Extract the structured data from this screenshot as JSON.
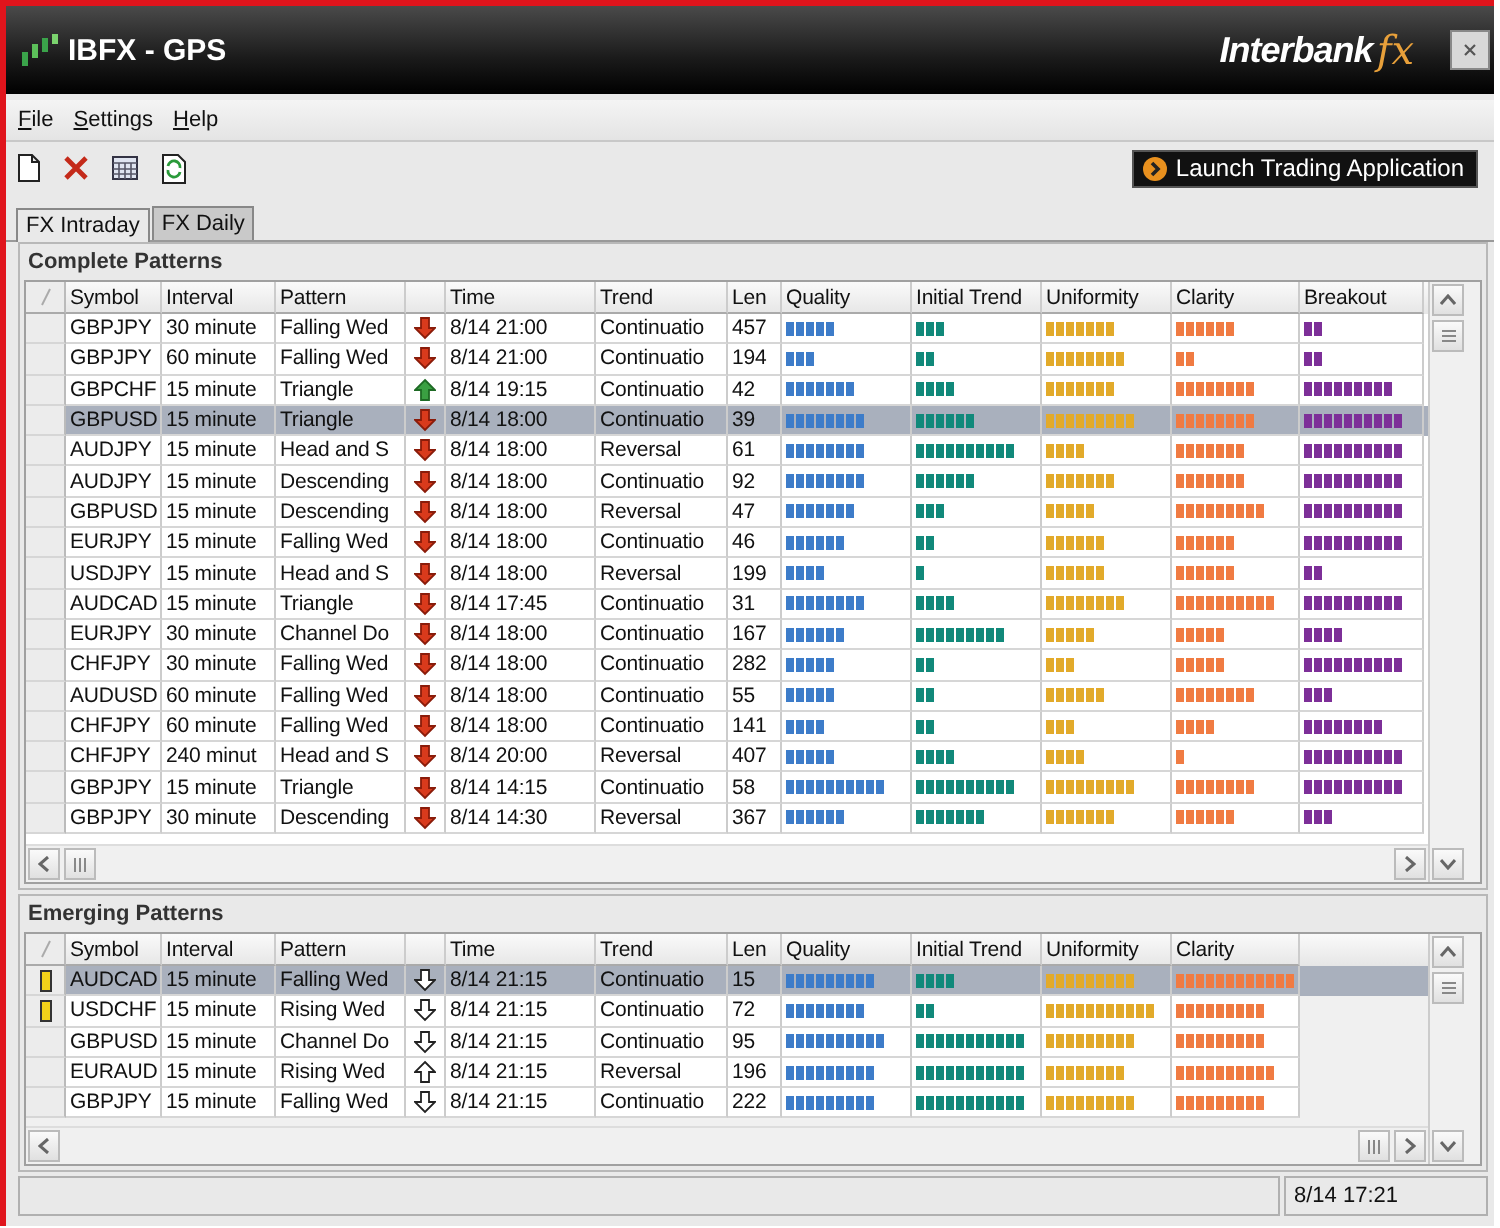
{
  "window": {
    "title": "IBFX - GPS",
    "brand": "Interbank",
    "brand_suffix": "fx"
  },
  "menu": [
    {
      "label": "File"
    },
    {
      "label": "Settings"
    },
    {
      "label": "Help"
    }
  ],
  "toolbar": {
    "launch_button": "Launch Trading Application"
  },
  "tabs": [
    {
      "label": "FX Intraday",
      "selected": true
    },
    {
      "label": "FX Daily",
      "selected": false
    }
  ],
  "complete_patterns": {
    "title": "Complete Patterns",
    "hollow_arrows": false,
    "columns": [
      {
        "label": "Symbol",
        "kind": "text"
      },
      {
        "label": "Interval",
        "kind": "text"
      },
      {
        "label": "Pattern",
        "kind": "text"
      },
      {
        "kind": "direction"
      },
      {
        "label": "Time",
        "kind": "text"
      },
      {
        "label": "Trend",
        "kind": "text"
      },
      {
        "label": "Len",
        "kind": "text"
      },
      {
        "label": "Quality",
        "kind": "bar",
        "color": "#3d7cc9"
      },
      {
        "label": "Initial Trend",
        "kind": "bar",
        "color": "#11897a"
      },
      {
        "label": "Uniformity",
        "kind": "bar",
        "color": "#e2aa2a"
      },
      {
        "label": "Clarity",
        "kind": "bar",
        "color": "#f07b42"
      },
      {
        "label": "Breakout",
        "kind": "bar",
        "color": "#7d2f98"
      }
    ],
    "rows": [
      {
        "selected": false,
        "cells": [
          "GBPJPY",
          "30 minute",
          "Falling Wed",
          {
            "up": false
          },
          "8/14 21:00",
          "Continuatio",
          "457",
          {
            "level": 0.42
          },
          {
            "level": 0.25
          },
          {
            "level": 0.58
          },
          {
            "level": 0.5
          },
          {
            "level": 0.17
          }
        ]
      },
      {
        "selected": false,
        "cells": [
          "GBPJPY",
          "60 minute",
          "Falling Wed",
          {
            "up": false
          },
          "8/14 21:00",
          "Continuatio",
          "194",
          {
            "level": 0.25
          },
          {
            "level": 0.17
          },
          {
            "level": 0.67
          },
          {
            "level": 0.17
          },
          {
            "level": 0.17
          }
        ]
      },
      {
        "selected": false,
        "cells": [
          "GBPCHF",
          "15 minute",
          "Triangle",
          {
            "up": true
          },
          "8/14 19:15",
          "Continuatio",
          "42",
          {
            "level": 0.58
          },
          {
            "level": 0.33
          },
          {
            "level": 0.58
          },
          {
            "level": 0.67
          },
          {
            "level": 0.75
          }
        ]
      },
      {
        "selected": true,
        "cells": [
          "GBPUSD",
          "15 minute",
          "Triangle",
          {
            "up": false
          },
          "8/14 18:00",
          "Continuatio",
          "39",
          {
            "level": 0.67
          },
          {
            "level": 0.5
          },
          {
            "level": 0.75
          },
          {
            "level": 0.67
          },
          {
            "level": 0.83
          }
        ]
      },
      {
        "selected": false,
        "cells": [
          "AUDJPY",
          "15 minute",
          "Head and S",
          {
            "up": false
          },
          "8/14 18:00",
          "Reversal",
          "61",
          {
            "level": 0.67
          },
          {
            "level": 0.83
          },
          {
            "level": 0.33
          },
          {
            "level": 0.58
          },
          {
            "level": 0.83
          }
        ]
      },
      {
        "selected": false,
        "cells": [
          "AUDJPY",
          "15 minute",
          "Descending",
          {
            "up": false
          },
          "8/14 18:00",
          "Continuatio",
          "92",
          {
            "level": 0.67
          },
          {
            "level": 0.5
          },
          {
            "level": 0.58
          },
          {
            "level": 0.58
          },
          {
            "level": 0.83
          }
        ]
      },
      {
        "selected": false,
        "cells": [
          "GBPUSD",
          "15 minute",
          "Descending",
          {
            "up": false
          },
          "8/14 18:00",
          "Reversal",
          "47",
          {
            "level": 0.58
          },
          {
            "level": 0.25
          },
          {
            "level": 0.42
          },
          {
            "level": 0.75
          },
          {
            "level": 0.83
          }
        ]
      },
      {
        "selected": false,
        "cells": [
          "EURJPY",
          "15 minute",
          "Falling Wed",
          {
            "up": false
          },
          "8/14 18:00",
          "Continuatio",
          "46",
          {
            "level": 0.5
          },
          {
            "level": 0.17
          },
          {
            "level": 0.5
          },
          {
            "level": 0.5
          },
          {
            "level": 0.83
          }
        ]
      },
      {
        "selected": false,
        "cells": [
          "USDJPY",
          "15 minute",
          "Head and S",
          {
            "up": false
          },
          "8/14 18:00",
          "Reversal",
          "199",
          {
            "level": 0.33
          },
          {
            "level": 0.08
          },
          {
            "level": 0.5
          },
          {
            "level": 0.5
          },
          {
            "level": 0.17
          }
        ]
      },
      {
        "selected": false,
        "cells": [
          "AUDCAD",
          "15 minute",
          "Triangle",
          {
            "up": false
          },
          "8/14 17:45",
          "Continuatio",
          "31",
          {
            "level": 0.67
          },
          {
            "level": 0.33
          },
          {
            "level": 0.67
          },
          {
            "level": 0.83
          },
          {
            "level": 0.83
          }
        ]
      },
      {
        "selected": false,
        "cells": [
          "EURJPY",
          "30 minute",
          "Channel Do",
          {
            "up": false
          },
          "8/14 18:00",
          "Continuatio",
          "167",
          {
            "level": 0.5
          },
          {
            "level": 0.75
          },
          {
            "level": 0.42
          },
          {
            "level": 0.42
          },
          {
            "level": 0.33
          }
        ]
      },
      {
        "selected": false,
        "cells": [
          "CHFJPY",
          "30 minute",
          "Falling Wed",
          {
            "up": false
          },
          "8/14 18:00",
          "Continuatio",
          "282",
          {
            "level": 0.42
          },
          {
            "level": 0.17
          },
          {
            "level": 0.25
          },
          {
            "level": 0.42
          },
          {
            "level": 0.83
          }
        ]
      },
      {
        "selected": false,
        "cells": [
          "AUDUSD",
          "60 minute",
          "Falling Wed",
          {
            "up": false
          },
          "8/14 18:00",
          "Continuatio",
          "55",
          {
            "level": 0.42
          },
          {
            "level": 0.17
          },
          {
            "level": 0.5
          },
          {
            "level": 0.67
          },
          {
            "level": 0.25
          }
        ]
      },
      {
        "selected": false,
        "cells": [
          "CHFJPY",
          "60 minute",
          "Falling Wed",
          {
            "up": false
          },
          "8/14 18:00",
          "Continuatio",
          "141",
          {
            "level": 0.33
          },
          {
            "level": 0.17
          },
          {
            "level": 0.25
          },
          {
            "level": 0.33
          },
          {
            "level": 0.67
          }
        ]
      },
      {
        "selected": false,
        "cells": [
          "CHFJPY",
          "240 minut",
          "Head and S",
          {
            "up": false
          },
          "8/14 20:00",
          "Reversal",
          "407",
          {
            "level": 0.42
          },
          {
            "level": 0.33
          },
          {
            "level": 0.33
          },
          {
            "level": 0.08
          },
          {
            "level": 0.83
          }
        ]
      },
      {
        "selected": false,
        "cells": [
          "GBPJPY",
          "15 minute",
          "Triangle",
          {
            "up": false
          },
          "8/14 14:15",
          "Continuatio",
          "58",
          {
            "level": 0.83
          },
          {
            "level": 0.83
          },
          {
            "level": 0.75
          },
          {
            "level": 0.67
          },
          {
            "level": 0.83
          }
        ]
      },
      {
        "selected": false,
        "cells": [
          "GBPJPY",
          "30 minute",
          "Descending",
          {
            "up": false
          },
          "8/14 14:30",
          "Reversal",
          "367",
          {
            "level": 0.5
          },
          {
            "level": 0.58
          },
          {
            "level": 0.58
          },
          {
            "level": 0.5
          },
          {
            "level": 0.25
          }
        ]
      }
    ]
  },
  "emerging_patterns": {
    "title": "Emerging Patterns",
    "hollow_arrows": true,
    "columns": [
      {
        "label": "Symbol",
        "kind": "text"
      },
      {
        "label": "Interval",
        "kind": "text"
      },
      {
        "label": "Pattern",
        "kind": "text"
      },
      {
        "kind": "direction"
      },
      {
        "label": "Time",
        "kind": "text"
      },
      {
        "label": "Trend",
        "kind": "text"
      },
      {
        "label": "Len",
        "kind": "text"
      },
      {
        "label": "Quality",
        "kind": "bar",
        "color": "#3d7cc9"
      },
      {
        "label": "Initial Trend",
        "kind": "bar",
        "color": "#11897a"
      },
      {
        "label": "Uniformity",
        "kind": "bar",
        "color": "#e2aa2a"
      },
      {
        "label": "Clarity",
        "kind": "bar",
        "color": "#f07b42"
      }
    ],
    "rows": [
      {
        "selected": true,
        "flagged": true,
        "cells": [
          "AUDCAD",
          "15 minute",
          "Falling Wed",
          {
            "up": false
          },
          "8/14 21:15",
          "Continuatio",
          "15",
          {
            "level": 0.75
          },
          {
            "level": 0.33
          },
          {
            "level": 0.75
          },
          {
            "level": 1
          }
        ]
      },
      {
        "selected": false,
        "flagged": true,
        "cells": [
          "USDCHF",
          "15 minute",
          "Rising Wed",
          {
            "up": false
          },
          "8/14 21:15",
          "Continuatio",
          "72",
          {
            "level": 0.67
          },
          {
            "level": 0.17
          },
          {
            "level": 0.92
          },
          {
            "level": 0.75
          }
        ]
      },
      {
        "selected": false,
        "flagged": false,
        "cells": [
          "GBPUSD",
          "15 minute",
          "Channel Do",
          {
            "up": false
          },
          "8/14 21:15",
          "Continuatio",
          "95",
          {
            "level": 0.83
          },
          {
            "level": 0.92
          },
          {
            "level": 0.75
          },
          {
            "level": 0.75
          }
        ]
      },
      {
        "selected": false,
        "flagged": false,
        "cells": [
          "EURAUD",
          "15 minute",
          "Rising Wed",
          {
            "up": true
          },
          "8/14 21:15",
          "Reversal",
          "196",
          {
            "level": 0.75
          },
          {
            "level": 0.92
          },
          {
            "level": 0.67
          },
          {
            "level": 0.83
          }
        ]
      },
      {
        "selected": false,
        "flagged": false,
        "cells": [
          "GBPJPY",
          "15 minute",
          "Falling Wed",
          {
            "up": false
          },
          "8/14 21:15",
          "Continuatio",
          "222",
          {
            "level": 0.75
          },
          {
            "level": 0.92
          },
          {
            "level": 0.75
          },
          {
            "level": 0.75
          }
        ]
      }
    ]
  },
  "status_bar": {
    "time": "8/14 17:21"
  }
}
